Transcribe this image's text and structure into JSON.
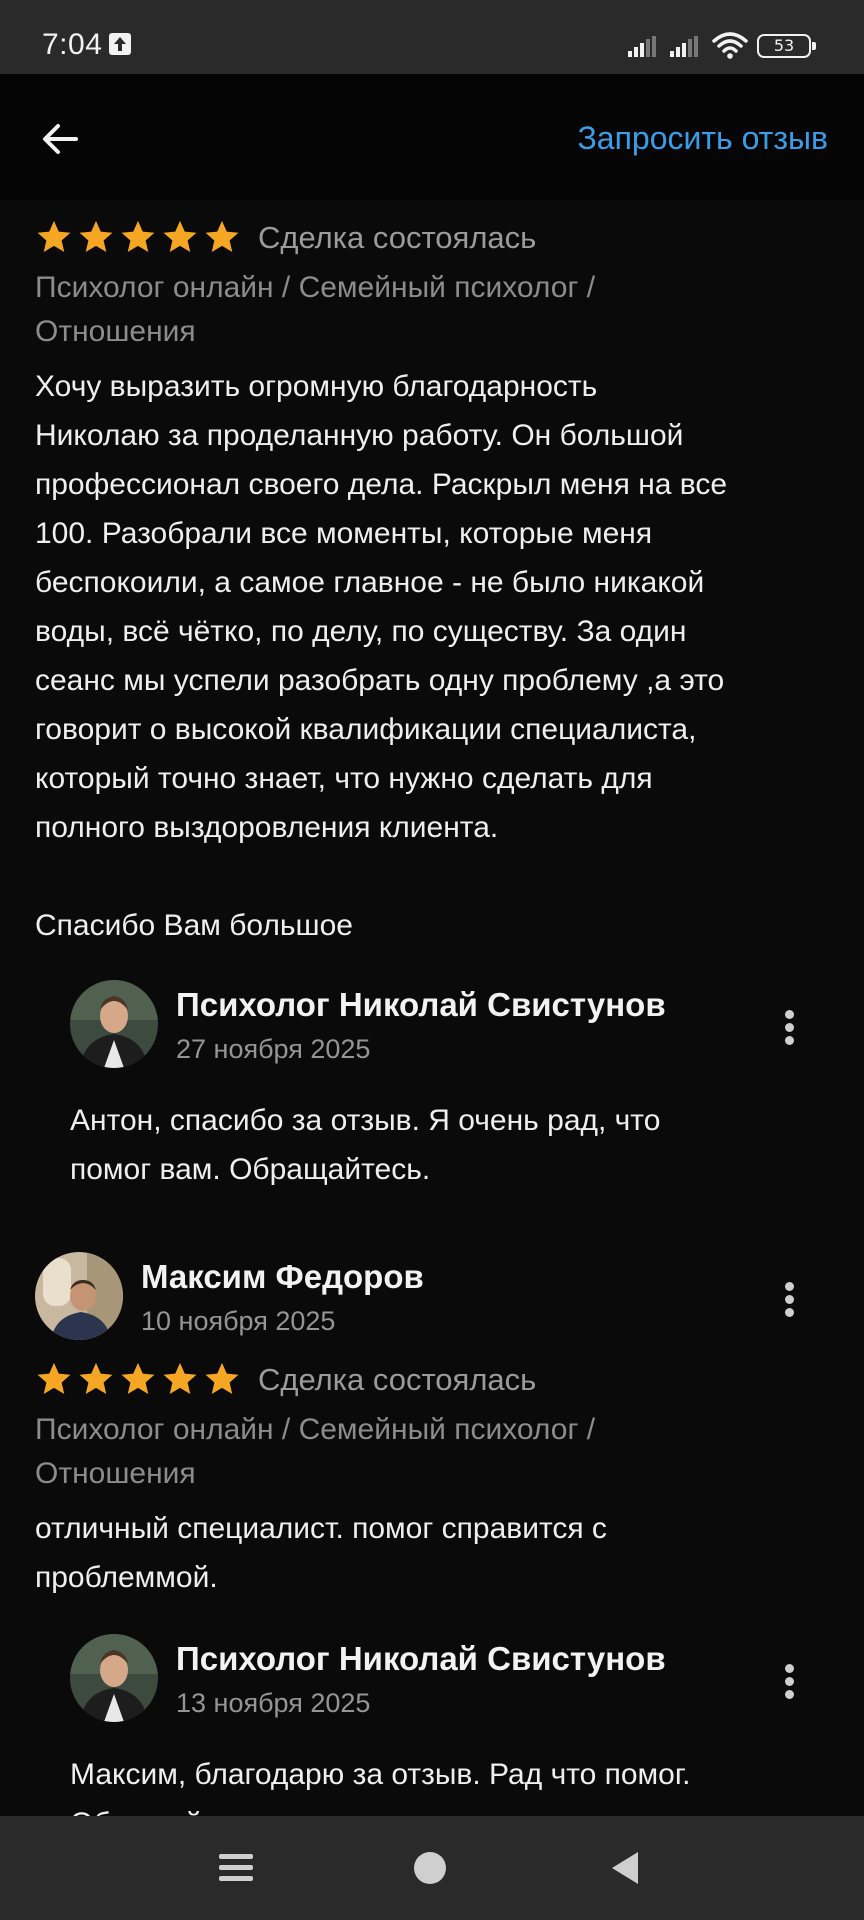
{
  "status_bar": {
    "time": "7:04",
    "battery": "53"
  },
  "header": {
    "request_review_label": "Запросить отзыв"
  },
  "colors": {
    "accent": "#3a9de8",
    "star": "#f5a623",
    "background": "#0a0a0a"
  },
  "reviews": [
    {
      "rating": 5,
      "deal_status": "Сделка состоялась",
      "category": "Психолог онлайн / Семейный психолог /\nОтношения",
      "text": "Хочу выразить огромную благодарность\nНиколаю за проделанную работу. Он большой\nпрофессионал своего дела. Раскрыл меня на все\n100. Разобрали все моменты, которые меня\nбеспокоили, а самое главное - не было никакой\nводы, всё чётко, по делу, по существу. За один\nсеанс мы успели разобрать одну проблему ,а это\nговорит о высокой квалификации специалиста,\nкоторый точно знает, что нужно сделать для\nполного выздоровления клиента.\n\nСпасибо Вам большое",
      "reply": {
        "author": "Психолог Николай Свистунов",
        "date": "27 ноября 2025",
        "text": "Антон, спасибо за отзыв. Я очень рад, что\nпомог вам. Обращайтесь."
      }
    },
    {
      "author": "Максим Федоров",
      "date": "10 ноября 2025",
      "rating": 5,
      "deal_status": "Сделка состоялась",
      "category": "Психолог онлайн / Семейный психолог /\nОтношения",
      "text": "отличный специалист. помог справится с\nпроблеммой.",
      "reply": {
        "author": "Психолог Николай Свистунов",
        "date": "13 ноября 2025",
        "text": "Максим, благодарю за отзыв. Рад что помог.\nОбращайтесь."
      }
    }
  ]
}
